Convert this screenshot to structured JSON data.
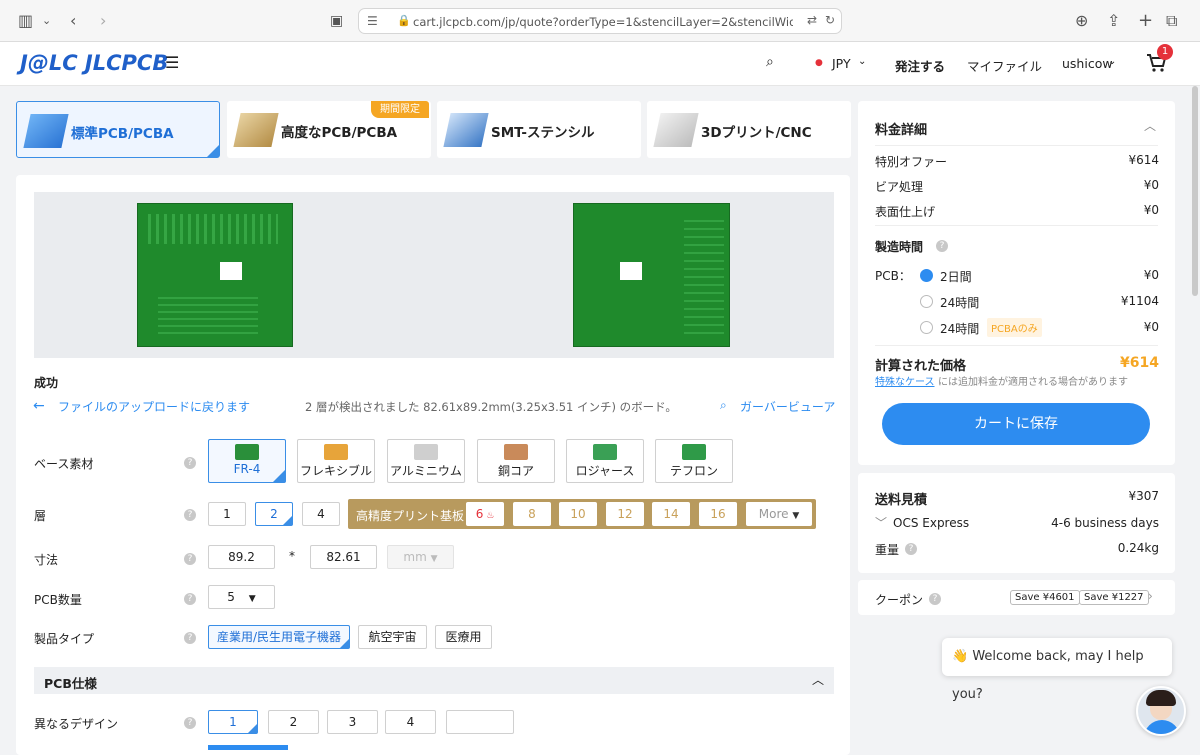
{
  "browser": {
    "url": "cart.jlcpcb.com/jp/quote?orderType=1&stencilLayer=2&stencilWidth=100&st"
  },
  "nav": {
    "logo": "J@LC JLCPCB",
    "currency": "JPY",
    "order": "発注する",
    "myfiles": "マイファイル",
    "user": "ushicow",
    "cart_count": "1"
  },
  "tabs": [
    {
      "label": "標準PCB/PCBA"
    },
    {
      "label": "高度なPCB/PCBA",
      "tag": "期間限定"
    },
    {
      "label": "SMT-ステンシル"
    },
    {
      "label": "3Dプリント/CNC"
    }
  ],
  "upload": {
    "status": "成功",
    "back_link": "ファイルのアップロードに戻ります",
    "detected": "2 層が検出されました 82.61x89.2mm(3.25x3.51 インチ) のボード。",
    "gerber_viewer": "ガーバービューア"
  },
  "form": {
    "base_material": {
      "label": "ベース素材",
      "options": [
        "FR-4",
        "フレキシブル",
        "アルミニウム",
        "銅コア",
        "ロジャース",
        "テフロン"
      ],
      "selected": "FR-4"
    },
    "layers": {
      "label": "層",
      "options": [
        "1",
        "2",
        "4"
      ],
      "selected": "2",
      "hp_label": "高精度プリント基板",
      "hp_options": [
        "6",
        "8",
        "10",
        "12",
        "14",
        "16"
      ],
      "more": "More"
    },
    "dimensions": {
      "label": "寸法",
      "width": "89.2",
      "sep": "*",
      "height": "82.61",
      "unit": "mm"
    },
    "quantity": {
      "label": "PCB数量",
      "value": "5"
    },
    "product_type": {
      "label": "製品タイプ",
      "options": [
        "産業用/民生用電子機器",
        "航空宇宙",
        "医療用"
      ],
      "selected": "産業用/民生用電子機器"
    },
    "spec_section": "PCB仕様",
    "designs": {
      "label": "異なるデザイン",
      "options": [
        "1",
        "2",
        "3",
        "4",
        ""
      ],
      "selected": "1"
    }
  },
  "price": {
    "title": "料金詳細",
    "rows": [
      {
        "label": "特別オファー",
        "value": "¥614"
      },
      {
        "label": "ビア処理",
        "value": "¥0"
      },
      {
        "label": "表面仕上げ",
        "value": "¥0"
      }
    ],
    "build_time_title": "製造時間",
    "pcb_label": "PCB：",
    "build_options": [
      {
        "label": "2日間",
        "value": "¥0",
        "checked": true
      },
      {
        "label": "24時間",
        "value": "¥1104",
        "checked": false
      },
      {
        "label": "24時間",
        "value": "¥0",
        "checked": false,
        "badge": "PCBAのみ"
      }
    ],
    "total_label": "計算された価格",
    "total_value": "¥614",
    "note_link": "特殊なケース",
    "note_rest": "には追加料金が適用される場合があります",
    "save_button": "カートに保存"
  },
  "shipping": {
    "title": "送料見積",
    "value": "¥307",
    "method": "OCS Express",
    "days": "4-6 business days",
    "weight_label": "重量",
    "weight": "0.24kg"
  },
  "coupon": {
    "label": "クーポン",
    "chips": [
      "Save ¥4601",
      "Save ¥1227"
    ]
  },
  "chat": {
    "message": "👋 Welcome back, may I help you?"
  },
  "colors": {
    "accent": "#2d8cf0",
    "price": "#f5a623",
    "gold": "#b89a5e"
  }
}
